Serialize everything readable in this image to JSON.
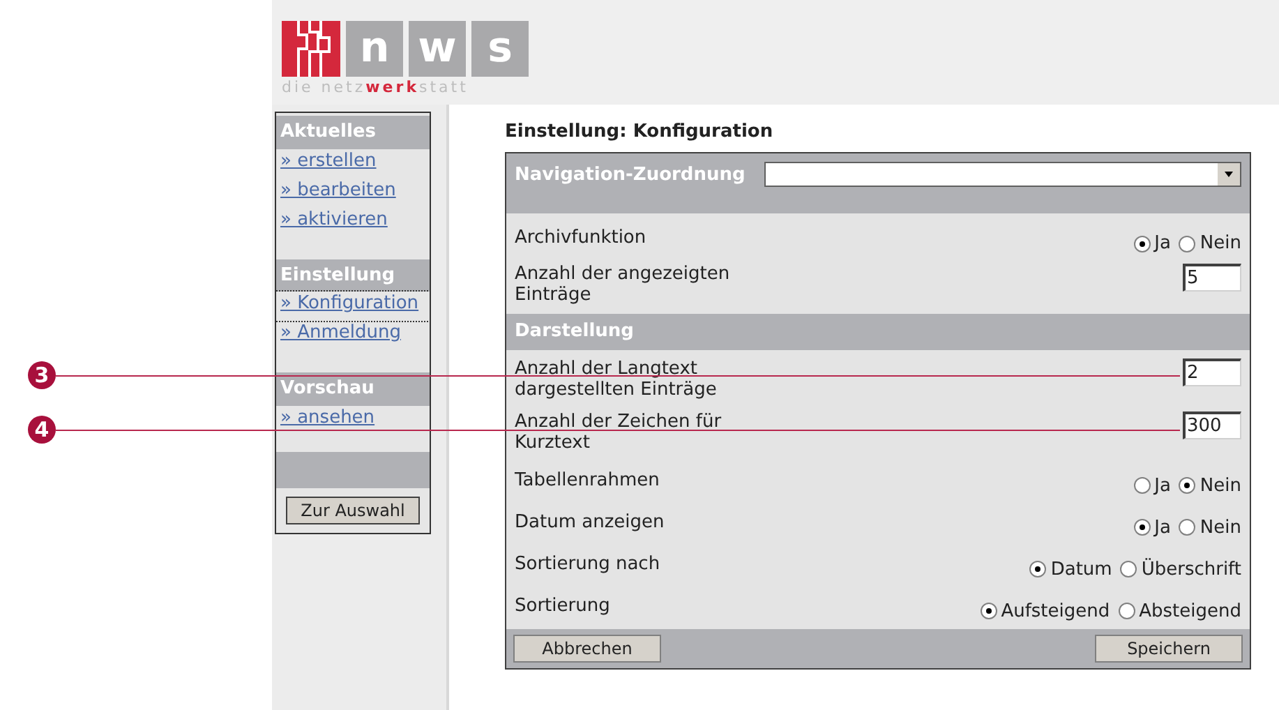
{
  "logo": {
    "letters": [
      "n",
      "w",
      "s"
    ],
    "tagline": [
      {
        "text": "die netz",
        "accent": false
      },
      {
        "text": "werk",
        "accent": true
      },
      {
        "text": "statt",
        "accent": false
      }
    ]
  },
  "sidebar": {
    "sections": [
      {
        "title": "Aktuelles",
        "items": [
          {
            "label": "» erstellen",
            "selected": false
          },
          {
            "label": "» bearbeiten",
            "selected": false
          },
          {
            "label": "» aktivieren",
            "selected": false
          }
        ]
      },
      {
        "title": "Einstellung",
        "items": [
          {
            "label": "» Konfiguration",
            "selected": true
          },
          {
            "label": "» Anmeldung",
            "selected": false
          }
        ]
      },
      {
        "title": "Vorschau",
        "items": [
          {
            "label": "» ansehen",
            "selected": false
          }
        ]
      }
    ],
    "button": "Zur Auswahl"
  },
  "page_title": "Einstellung: Konfiguration",
  "form": {
    "navigation": {
      "label": "Navigation-Zuordnung"
    },
    "rows": [
      {
        "kind": "radio",
        "label": "Archivfunktion",
        "options": [
          {
            "label": "Ja",
            "selected": true
          },
          {
            "label": "Nein",
            "selected": false
          }
        ]
      },
      {
        "kind": "number",
        "label": "Anzahl der angezeigten Einträge",
        "value": "5"
      },
      {
        "kind": "section",
        "label": "Darstellung"
      },
      {
        "kind": "number",
        "label": "Anzahl der Langtext dargestellten Einträge",
        "value": "2"
      },
      {
        "kind": "number",
        "label": "Anzahl der Zeichen für Kurztext",
        "value": "300"
      },
      {
        "kind": "radio",
        "label": "Tabellenrahmen",
        "options": [
          {
            "label": "Ja",
            "selected": false
          },
          {
            "label": "Nein",
            "selected": true
          }
        ]
      },
      {
        "kind": "radio",
        "label": "Datum anzeigen",
        "options": [
          {
            "label": "Ja",
            "selected": true
          },
          {
            "label": "Nein",
            "selected": false
          }
        ]
      },
      {
        "kind": "radio",
        "label": "Sortierung nach",
        "options": [
          {
            "label": "Datum",
            "selected": true
          },
          {
            "label": "Überschrift",
            "selected": false
          }
        ]
      },
      {
        "kind": "radio",
        "label": "Sortierung",
        "options": [
          {
            "label": "Aufsteigend",
            "selected": true
          },
          {
            "label": "Absteigend",
            "selected": false
          }
        ]
      }
    ],
    "buttons": [
      "Abbrechen",
      "Speichern"
    ]
  },
  "callouts": [
    {
      "number": "3"
    },
    {
      "number": "4"
    }
  ]
}
